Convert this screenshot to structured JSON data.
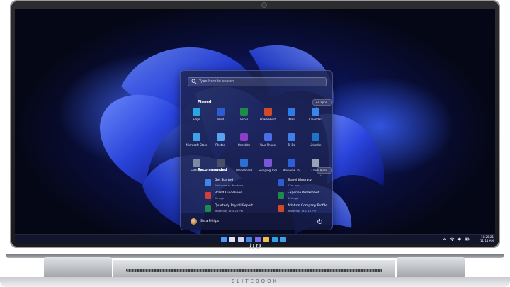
{
  "device": {
    "logo": "hp",
    "brand": "ELITEBOOK"
  },
  "start_menu": {
    "search_placeholder": "Type here to search",
    "pinned": {
      "title": "Pinned",
      "all_apps_label": "All apps  ›",
      "apps": [
        {
          "label": "Edge",
          "icon": "edge-icon",
          "color": "#2aa7e3"
        },
        {
          "label": "Word",
          "icon": "word-icon",
          "color": "#2b5cd0"
        },
        {
          "label": "Excel",
          "icon": "excel-icon",
          "color": "#1e8a4c"
        },
        {
          "label": "PowerPoint",
          "icon": "powerpoint-icon",
          "color": "#d2492a"
        },
        {
          "label": "Mail",
          "icon": "mail-icon",
          "color": "#2f7ae5"
        },
        {
          "label": "Calendar",
          "icon": "calendar-icon",
          "color": "#3b86e6"
        },
        {
          "label": "Microsoft Store",
          "icon": "store-icon",
          "color": "#3fa1ec"
        },
        {
          "label": "Photos",
          "icon": "photos-icon",
          "color": "#5aa3f0"
        },
        {
          "label": "OneNote",
          "icon": "onenote-icon",
          "color": "#8b3fc6"
        },
        {
          "label": "Your Phone",
          "icon": "phone-icon",
          "color": "#4c6fe8"
        },
        {
          "label": "To Do",
          "icon": "todo-icon",
          "color": "#3e7fe8"
        },
        {
          "label": "LinkedIn",
          "icon": "linkedin-icon",
          "color": "#1c75c7"
        },
        {
          "label": "Settings",
          "icon": "settings-icon",
          "color": "#7e8aa3"
        },
        {
          "label": "Calculator",
          "icon": "calculator-icon",
          "color": "#4a5068"
        },
        {
          "label": "Whiteboard",
          "icon": "whiteboard-icon",
          "color": "#2d6fd2"
        },
        {
          "label": "Snipping Tool",
          "icon": "snipping-tool-icon",
          "color": "#7a56d8"
        },
        {
          "label": "Movies & TV",
          "icon": "movies-tv-icon",
          "color": "#2c5fd6"
        },
        {
          "label": "Clock",
          "icon": "clock-icon",
          "color": "#9aa3b5"
        }
      ]
    },
    "recommended": {
      "title": "Recommended",
      "more_label": "More  ›",
      "items": [
        {
          "name": "Get Started",
          "detail": "Welcome to Windows",
          "icon": "get-started-icon",
          "color": "#3f86ea"
        },
        {
          "name": "Travel Itinerary",
          "detail": "17m ago",
          "icon": "word-doc-icon",
          "color": "#2b5cd0"
        },
        {
          "name": "Brand Guidelines",
          "detail": "2h ago",
          "icon": "pdf-icon",
          "color": "#d2403a"
        },
        {
          "name": "Expense Worksheet",
          "detail": "12h ago",
          "icon": "excel-doc-icon",
          "color": "#1e8a4c"
        },
        {
          "name": "Quarterly Payroll Report",
          "detail": "Yesterday at 4:24 PM",
          "icon": "excel-doc-icon",
          "color": "#1e8a4c"
        },
        {
          "name": "Adatum Company Profile",
          "detail": "Yesterday at 1:15 PM",
          "icon": "powerpoint-doc-icon",
          "color": "#d2492a"
        }
      ]
    },
    "user": {
      "name": "Sara Philips"
    }
  },
  "taskbar": {
    "items": [
      {
        "icon": "start-icon",
        "color": "#4a9cff"
      },
      {
        "icon": "search-icon",
        "color": "#dfe3f2"
      },
      {
        "icon": "task-view-icon",
        "color": "#cfd5ea"
      },
      {
        "icon": "widgets-icon",
        "color": "#3f86ea"
      },
      {
        "icon": "chat-icon",
        "color": "#7b6cf0"
      },
      {
        "icon": "file-explorer-icon",
        "color": "#f1c14b"
      },
      {
        "icon": "edge-icon",
        "color": "#2aa7e3"
      },
      {
        "icon": "store-icon",
        "color": "#3fa1ec"
      }
    ],
    "time": "10:20:21",
    "date": "11:11 AM"
  }
}
